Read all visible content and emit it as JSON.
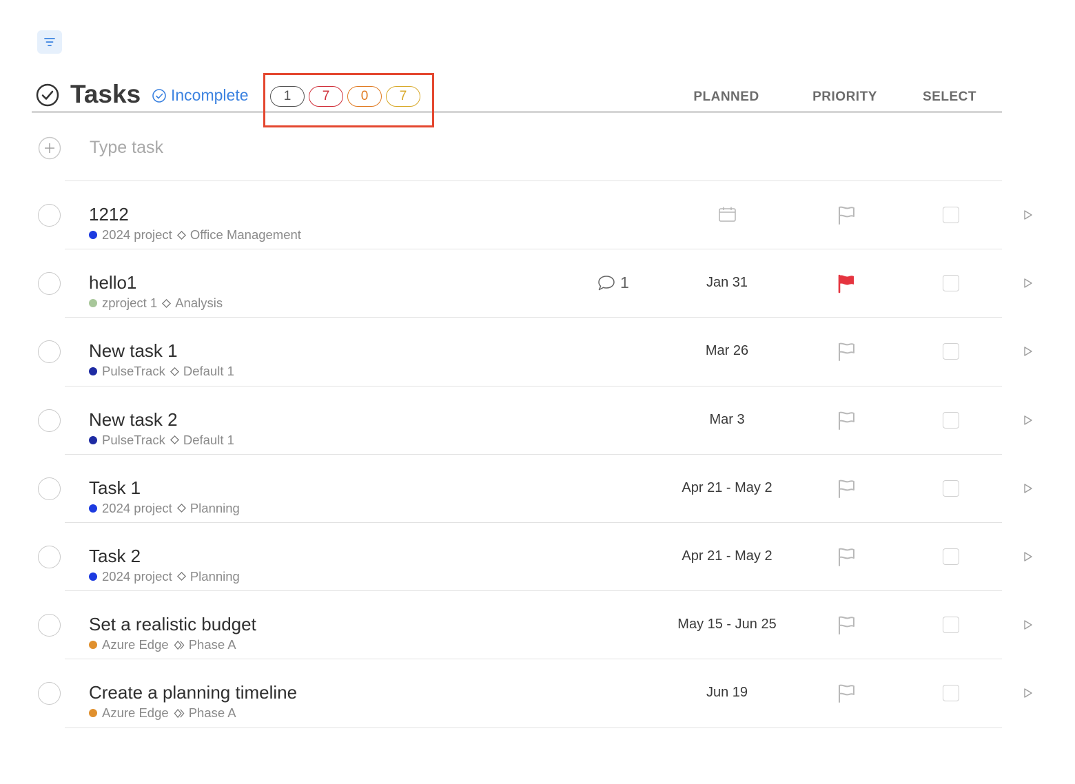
{
  "toolbar": {
    "filter_icon": "filter-lines-icon"
  },
  "header": {
    "title": "Tasks",
    "status_filter": "Incomplete",
    "counters": [
      {
        "value": "1",
        "color": "#555555"
      },
      {
        "value": "7",
        "color": "#d0303a"
      },
      {
        "value": "0",
        "color": "#e07b22"
      },
      {
        "value": "7",
        "color": "#d8a92a"
      }
    ],
    "columns": {
      "planned": "PLANNED",
      "priority": "PRIORITY",
      "select": "SELECT"
    }
  },
  "add_task": {
    "placeholder": "Type task"
  },
  "tasks": [
    {
      "title": "1212",
      "project": "2024 project",
      "project_color": "#1d3be0",
      "section": "Office Management",
      "section_icon": "diamond",
      "comments": "",
      "planned": "",
      "planned_icon": "calendar",
      "priority_flag": false
    },
    {
      "title": "hello1",
      "project": "zproject 1",
      "project_color": "#a8c79a",
      "section": "Analysis",
      "section_icon": "diamond",
      "comments": "1",
      "planned": "Jan 31",
      "planned_icon": "",
      "priority_flag": true
    },
    {
      "title": "New task 1",
      "project": "PulseTrack",
      "project_color": "#1e2ba3",
      "section": "Default 1",
      "section_icon": "diamond",
      "comments": "",
      "planned": "Mar 26",
      "planned_icon": "",
      "priority_flag": false
    },
    {
      "title": "New task 2",
      "project": "PulseTrack",
      "project_color": "#1e2ba3",
      "section": "Default 1",
      "section_icon": "diamond",
      "comments": "",
      "planned": "Mar 3",
      "planned_icon": "",
      "priority_flag": false
    },
    {
      "title": "Task 1",
      "project": "2024 project",
      "project_color": "#1d3be0",
      "section": "Planning",
      "section_icon": "diamond",
      "comments": "",
      "planned": "Apr 21 - May 2",
      "planned_icon": "",
      "priority_flag": false
    },
    {
      "title": "Task 2",
      "project": "2024 project",
      "project_color": "#1d3be0",
      "section": "Planning",
      "section_icon": "diamond",
      "comments": "",
      "planned": "Apr 21 - May 2",
      "planned_icon": "",
      "priority_flag": false
    },
    {
      "title": "Set a realistic budget",
      "project": "Azure Edge",
      "project_color": "#e0902e",
      "section": "Phase A",
      "section_icon": "double-diamond",
      "comments": "",
      "planned": "May 15 - Jun 25",
      "planned_icon": "",
      "priority_flag": false
    },
    {
      "title": "Create a planning timeline",
      "project": "Azure Edge",
      "project_color": "#e0902e",
      "section": "Phase A",
      "section_icon": "double-diamond",
      "comments": "",
      "planned": "Jun 19",
      "planned_icon": "",
      "priority_flag": false
    }
  ],
  "colors": {
    "accent": "#3b82e0",
    "priority_flag": "#e5343f",
    "highlight": "#e4472f"
  }
}
